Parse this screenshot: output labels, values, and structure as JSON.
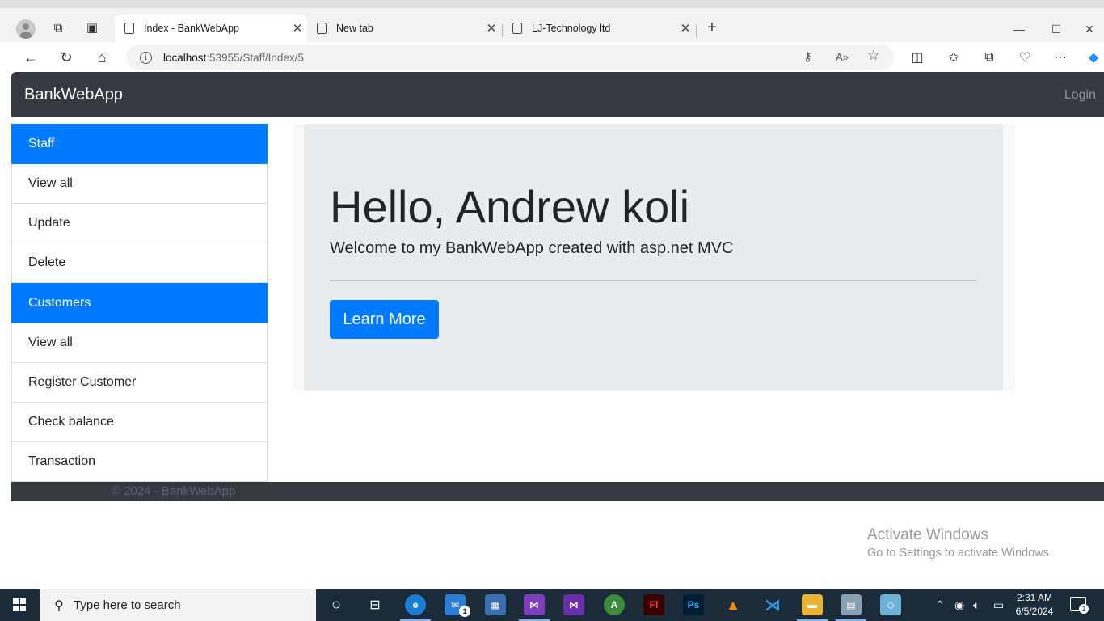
{
  "browser": {
    "tabs": [
      {
        "title": "Index - BankWebApp"
      },
      {
        "title": "New tab"
      },
      {
        "title": "LJ-Technology ltd"
      }
    ],
    "url_host": "localhost",
    "url_rest": ":53955/Staff/Index/5"
  },
  "app": {
    "brand": "BankWebApp",
    "login": "Login"
  },
  "sidebar": {
    "items": [
      {
        "label": "Staff",
        "header": true
      },
      {
        "label": "View all"
      },
      {
        "label": "Update"
      },
      {
        "label": "Delete"
      },
      {
        "label": "Customers",
        "header": true
      },
      {
        "label": "View all"
      },
      {
        "label": "Register Customer"
      },
      {
        "label": "Check balance"
      },
      {
        "label": "Transaction"
      }
    ]
  },
  "jumbotron": {
    "heading": "Hello, Andrew koli",
    "lead": "Welcome to my BankWebApp created with asp.net MVC",
    "button": "Learn More"
  },
  "footer": {
    "text": "© 2024 - BankWebApp"
  },
  "watermark": {
    "line1": "Activate Windows",
    "line2": "Go to Settings to activate Windows."
  },
  "taskbar": {
    "search_placeholder": "Type here to search",
    "time": "2:31 AM",
    "date": "6/5/2024",
    "notification_count": "1",
    "mail_badge": "1"
  },
  "colors": {
    "primary": "#007bff",
    "navbar": "#343a40",
    "jumbotron": "#e9ecef",
    "taskbar": "#1c2b3a"
  }
}
